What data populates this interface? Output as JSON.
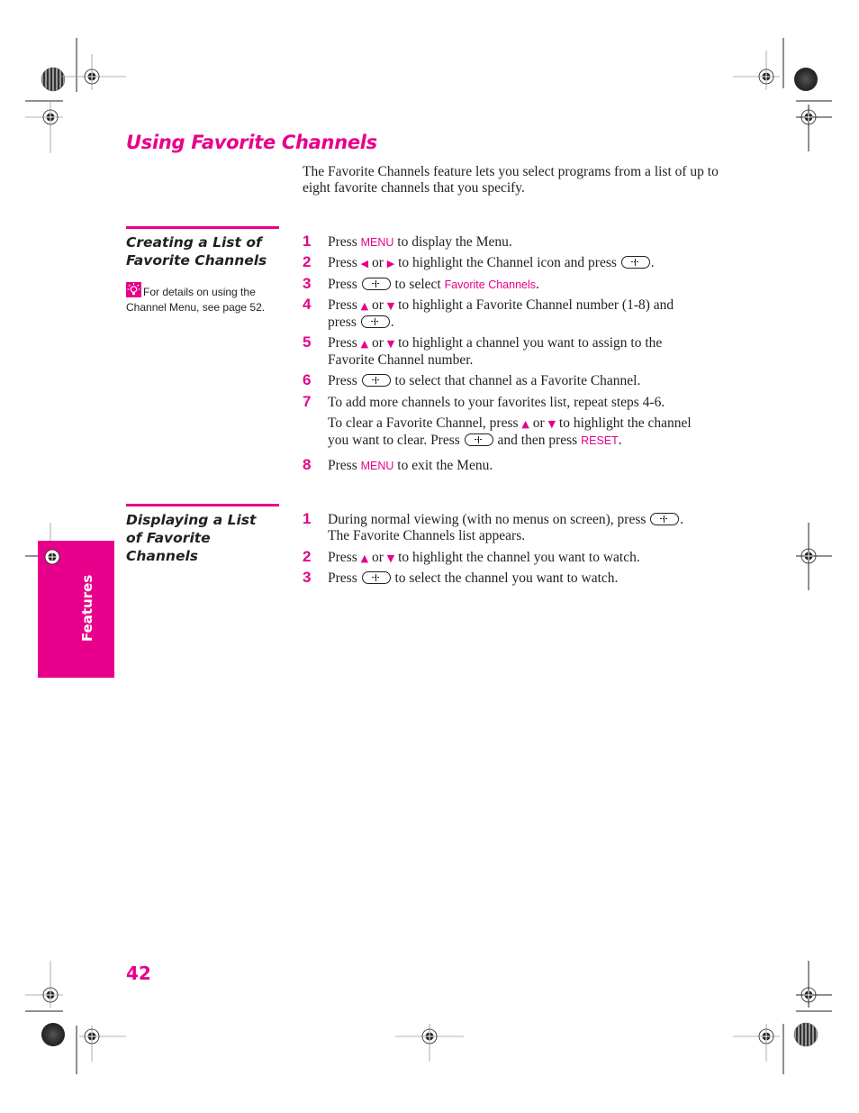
{
  "page": {
    "title": "Using Favorite Channels",
    "intro": "The Favorite Channels feature lets you select programs from a list of up to eight favorite channels that you specify.",
    "side_tab": "Features",
    "page_number": "42",
    "accent_color": "#e8008c"
  },
  "section1": {
    "heading_line1": "Creating a List of",
    "heading_line2": "Favorite Channels",
    "tip": {
      "icon": "lightbulb-tip-icon",
      "line1": "For details on using the",
      "line2": "Channel Menu, see page 52."
    },
    "steps": [
      {
        "num": "1",
        "a": "Press ",
        "kw": "MENU",
        "b": " to display the Menu."
      },
      {
        "num": "2",
        "a": "Press ",
        "arrow1": "◆",
        "or": " or ",
        "arrow2": "◆",
        "b": " to highlight the Channel icon and press ",
        "c": "."
      },
      {
        "num": "3",
        "a": "Press ",
        "b": " to select ",
        "kw": "Favorite Channels",
        "c": "."
      },
      {
        "num": "4",
        "a": "Press ",
        "or": " or ",
        "b": " to highlight a Favorite Channel number (1-8) and",
        "line2a": "press ",
        "line2b": "."
      },
      {
        "num": "5",
        "a": "Press ",
        "or": " or ",
        "b": " to highlight a channel you want to assign to the",
        "line2": "Favorite Channel number."
      },
      {
        "num": "6",
        "a": "Press ",
        "b": " to select that channel as a Favorite Channel."
      },
      {
        "num": "7",
        "a": "To add more channels to your favorites list, repeat steps 4-6."
      },
      {
        "num": "8",
        "a": "Press ",
        "kw": "MENU",
        "b": " to exit the Menu."
      }
    ],
    "note": {
      "a": "To clear a Favorite Channel, press ",
      "or": " or ",
      "b": " to highlight the channel",
      "line2a": "you want to clear. Press ",
      "line2b": " and then press ",
      "kw": "RESET",
      "c": "."
    }
  },
  "section2": {
    "heading_line1": "Displaying a List",
    "heading_line2": "of Favorite",
    "heading_line3": "Channels",
    "steps": [
      {
        "num": "1",
        "a": "During normal viewing (with no menus on screen), press ",
        "c": ".",
        "line2": "The Favorite Channels list appears."
      },
      {
        "num": "2",
        "a": "Press ",
        "or": " or ",
        "b": " to highlight the channel you want to watch."
      },
      {
        "num": "3",
        "a": "Press ",
        "b": " to select the channel you want to watch."
      }
    ]
  },
  "icons": {
    "left": "◆",
    "right": "◆",
    "up": "▲",
    "down": "▼"
  }
}
